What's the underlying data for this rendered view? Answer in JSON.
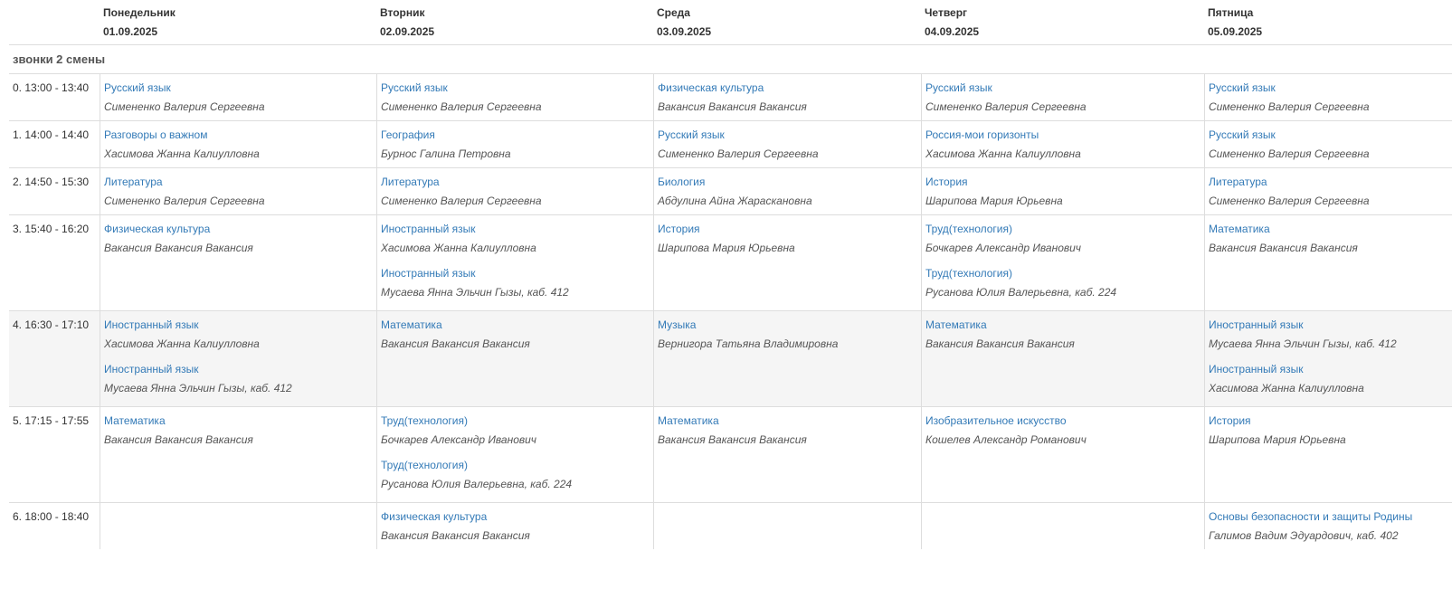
{
  "header": {
    "days": [
      {
        "name": "Понедельник",
        "date": "01.09.2025"
      },
      {
        "name": "Вторник",
        "date": "02.09.2025"
      },
      {
        "name": "Среда",
        "date": "03.09.2025"
      },
      {
        "name": "Четверг",
        "date": "04.09.2025"
      },
      {
        "name": "Пятница",
        "date": "05.09.2025"
      }
    ]
  },
  "shift_label": "звонки 2 смены",
  "rows": [
    {
      "time": "0. 13:00 - 13:40",
      "cells": [
        [
          {
            "subject": "Русский язык",
            "teacher": "Симененко Валерия Сергеевна"
          }
        ],
        [
          {
            "subject": "Русский язык",
            "teacher": "Симененко Валерия Сергеевна"
          }
        ],
        [
          {
            "subject": "Физическая культура",
            "teacher": "Вакансия Вакансия Вакансия"
          }
        ],
        [
          {
            "subject": "Русский язык",
            "teacher": "Симененко Валерия Сергеевна"
          }
        ],
        [
          {
            "subject": "Русский язык",
            "teacher": "Симененко Валерия Сергеевна"
          }
        ]
      ]
    },
    {
      "time": "1. 14:00 - 14:40",
      "cells": [
        [
          {
            "subject": "Разговоры о важном",
            "teacher": "Хасимова Жанна Калиулловна"
          }
        ],
        [
          {
            "subject": "География",
            "teacher": "Бурнос Галина Петровна"
          }
        ],
        [
          {
            "subject": "Русский язык",
            "teacher": "Симененко Валерия Сергеевна"
          }
        ],
        [
          {
            "subject": "Россия-мои горизонты",
            "teacher": "Хасимова Жанна Калиулловна"
          }
        ],
        [
          {
            "subject": "Русский язык",
            "teacher": "Симененко Валерия Сергеевна"
          }
        ]
      ]
    },
    {
      "time": "2. 14:50 - 15:30",
      "cells": [
        [
          {
            "subject": "Литература",
            "teacher": "Симененко Валерия Сергеевна"
          }
        ],
        [
          {
            "subject": "Литература",
            "teacher": "Симененко Валерия Сергеевна"
          }
        ],
        [
          {
            "subject": "Биология",
            "teacher": "Абдулина Айна Жарaскановна"
          }
        ],
        [
          {
            "subject": "История",
            "teacher": "Шарипова Мария Юрьевна"
          }
        ],
        [
          {
            "subject": "Литература",
            "teacher": "Симененко Валерия Сергеевна"
          }
        ]
      ]
    },
    {
      "time": "3. 15:40 - 16:20",
      "cells": [
        [
          {
            "subject": "Физическая культура",
            "teacher": "Вакансия Вакансия Вакансия"
          }
        ],
        [
          {
            "subject": "Иностранный язык",
            "teacher": "Хасимова Жанна Калиулловна"
          },
          {
            "subject": "Иностранный язык",
            "teacher": "Мусаева Янна Эльчин Гызы, каб. 412"
          }
        ],
        [
          {
            "subject": "История",
            "teacher": "Шарипова Мария Юрьевна"
          }
        ],
        [
          {
            "subject": "Труд(технология)",
            "teacher": "Бочкарев Александр Иванович"
          },
          {
            "subject": "Труд(технология)",
            "teacher": "Русанова Юлия Валерьевна, каб. 224"
          }
        ],
        [
          {
            "subject": "Математика",
            "teacher": "Вакансия Вакансия Вакансия"
          }
        ]
      ]
    },
    {
      "time": "4. 16:30 - 17:10",
      "cells": [
        [
          {
            "subject": "Иностранный язык",
            "teacher": "Хасимова Жанна Калиулловна"
          },
          {
            "subject": "Иностранный язык",
            "teacher": "Мусаева Янна Эльчин Гызы, каб. 412"
          }
        ],
        [
          {
            "subject": "Математика",
            "teacher": "Вакансия Вакансия Вакансия"
          }
        ],
        [
          {
            "subject": "Музыка",
            "teacher": "Вернигора Татьяна Владимировна"
          }
        ],
        [
          {
            "subject": "Математика",
            "teacher": "Вакансия Вакансия Вакансия"
          }
        ],
        [
          {
            "subject": "Иностранный язык",
            "teacher": "Мусаева Янна Эльчин Гызы, каб. 412"
          },
          {
            "subject": "Иностранный язык",
            "teacher": "Хасимова Жанна Калиулловна"
          }
        ]
      ]
    },
    {
      "time": "5. 17:15 - 17:55",
      "cells": [
        [
          {
            "subject": "Математика",
            "teacher": "Вакансия Вакансия Вакансия"
          }
        ],
        [
          {
            "subject": "Труд(технология)",
            "teacher": "Бочкарев Александр Иванович"
          },
          {
            "subject": "Труд(технология)",
            "teacher": "Русанова Юлия Валерьевна, каб. 224"
          }
        ],
        [
          {
            "subject": "Математика",
            "teacher": "Вакансия Вакансия Вакансия"
          }
        ],
        [
          {
            "subject": "Изобразительное искусство",
            "teacher": "Кошелев Александр Романович"
          }
        ],
        [
          {
            "subject": "История",
            "teacher": "Шарипова Мария Юрьевна"
          }
        ]
      ]
    },
    {
      "time": "6. 18:00 - 18:40",
      "cells": [
        [],
        [
          {
            "subject": "Физическая культура",
            "teacher": "Вакансия Вакансия Вакансия"
          }
        ],
        [],
        [],
        [
          {
            "subject": "Основы безопасности и защиты Родины",
            "teacher": "Галимов Вадим Эдуардович, каб. 402"
          }
        ]
      ]
    }
  ]
}
